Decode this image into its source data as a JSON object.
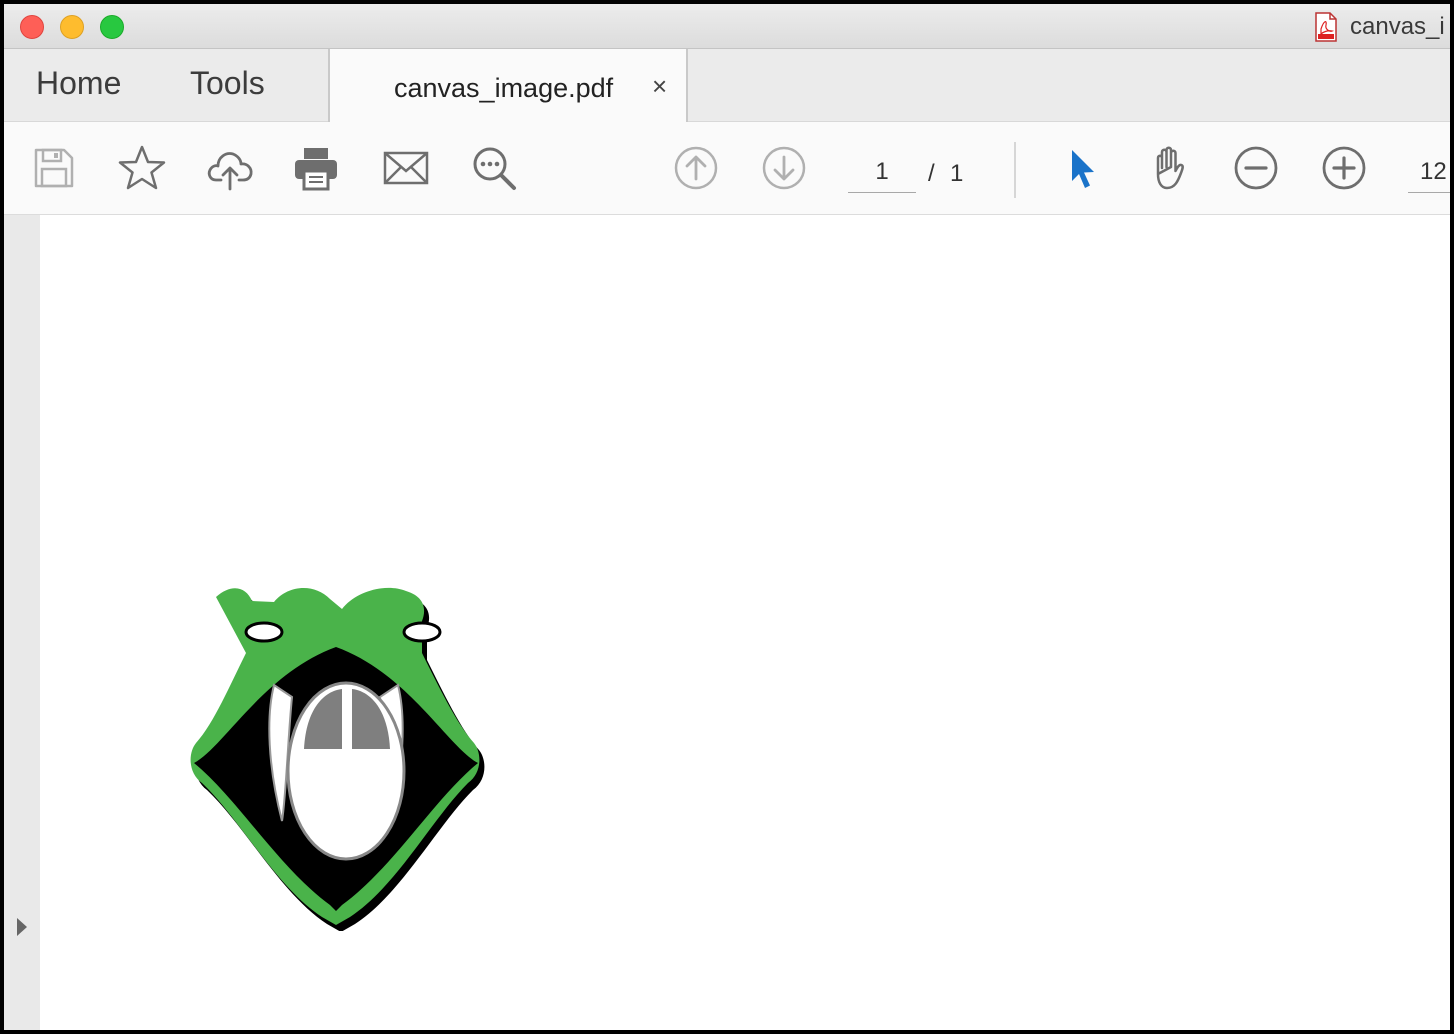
{
  "window": {
    "title": "canvas_i"
  },
  "nav": {
    "home_label": "Home",
    "tools_label": "Tools"
  },
  "document_tab": {
    "label": "canvas_image.pdf",
    "close_glyph": "×"
  },
  "toolbar": {
    "icons": [
      "save-icon",
      "star-icon",
      "cloud-upload-icon",
      "printer-icon",
      "envelope-icon",
      "search-icon",
      "previous-page-icon",
      "next-page-icon",
      "select-pointer-icon",
      "hand-icon",
      "zoom-out-icon",
      "zoom-in-icon"
    ],
    "page_current": "1",
    "page_separator": "/",
    "page_total": "1",
    "zoom_value": "12"
  },
  "colors": {
    "pointer_active": "#1a73c9",
    "icon_gray": "#6e6e6e",
    "icon_disabled": "#b0b0b0",
    "logo_green": "#4ab34a"
  }
}
